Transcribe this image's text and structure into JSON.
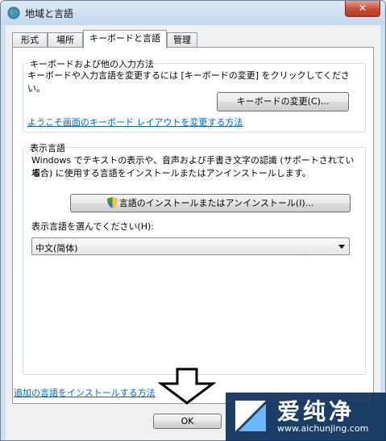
{
  "window": {
    "title": "地域と言語",
    "close_label": "✕"
  },
  "tabs": [
    {
      "label": "形式",
      "active": false
    },
    {
      "label": "場所",
      "active": false
    },
    {
      "label": "キーボードと言語",
      "active": true
    },
    {
      "label": "管理",
      "active": false
    }
  ],
  "keyboard_group": {
    "title": "キーボードおよび他の入力方法",
    "description": "キーボードや入力言語を変更するには [キーボードの変更] をクリックしてください。",
    "change_button": "キーボードの変更(C)...",
    "welcome_link": "ようこそ画面のキーボード レイアウトを変更する方法"
  },
  "display_group": {
    "title": "表示言語",
    "description_line1": "Windows でテキストの表示や、音声および手書き文字の認識 (サポートされている",
    "description_line2": "場合) に使用する言語をインストールまたはアンインストールします。",
    "install_button": "言語のインストールまたはアンインストール(I)...",
    "select_label": "表示言語を選んでください(H):",
    "selected_language": "中文(简体)"
  },
  "footer": {
    "install_link": "追加の言語をインストールする方法",
    "ok_button": "OK"
  },
  "watermark": {
    "title": "爱纯净",
    "url": "www.aichunjing.com"
  },
  "colors": {
    "link": "#0066cc",
    "window_frame": "#cde0f2",
    "watermark_bg": "#0b2f5a"
  }
}
